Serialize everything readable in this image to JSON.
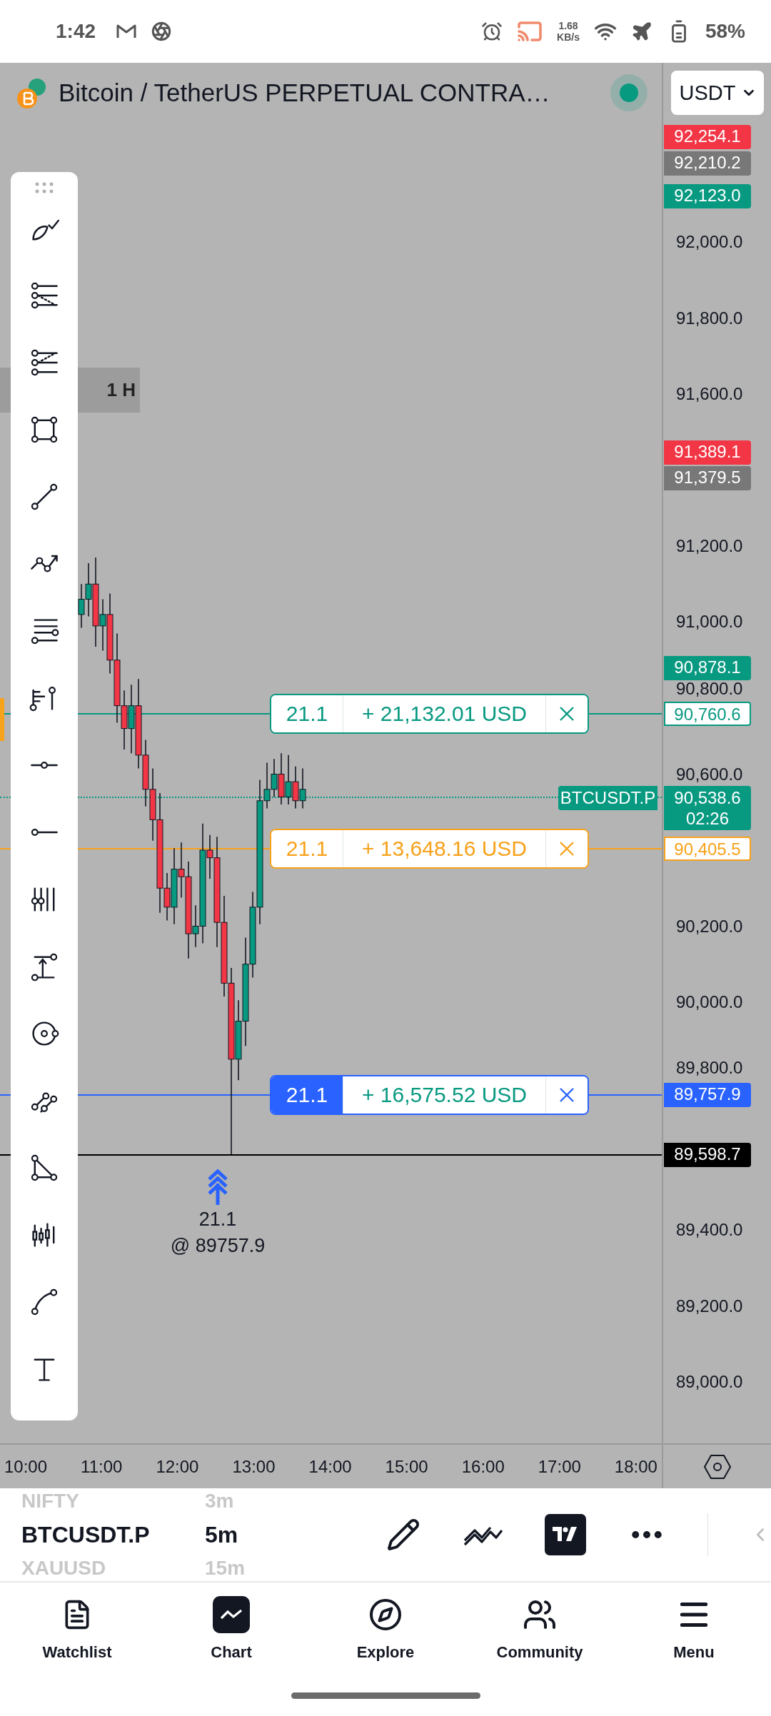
{
  "status_bar": {
    "time": "1:42",
    "net_speed": "1.68",
    "net_unit": "KB/s",
    "battery": "58%"
  },
  "header": {
    "title": "Bitcoin / TetherUS PERPETUAL CONTRA…",
    "live": true,
    "currency": "USDT"
  },
  "interval_label": "1 H",
  "price_axis": [
    {
      "label": "92,254.1",
      "kind": "tag",
      "color": "#f23645"
    },
    {
      "label": "92,210.2",
      "kind": "tag",
      "color": "#787878"
    },
    {
      "label": "92,123.0",
      "kind": "tag",
      "color": "#089981"
    },
    {
      "label": "92,000.0",
      "kind": "tick"
    },
    {
      "label": "91,800.0",
      "kind": "tick"
    },
    {
      "label": "91,600.0",
      "kind": "tick"
    },
    {
      "label": "91,389.1",
      "kind": "tag",
      "color": "#f23645"
    },
    {
      "label": "91,379.5",
      "kind": "tag",
      "color": "#787878"
    },
    {
      "label": "91,200.0",
      "kind": "tick"
    },
    {
      "label": "91,000.0",
      "kind": "tick"
    },
    {
      "label": "90,878.1",
      "kind": "tag",
      "color": "#089981"
    },
    {
      "label": "90,800.0",
      "kind": "tick"
    },
    {
      "label": "90,760.6",
      "kind": "outline",
      "color": "#089981"
    },
    {
      "label": "90,600.0",
      "kind": "tick"
    },
    {
      "label": "90,405.5",
      "kind": "outline",
      "color": "#f7a21b"
    },
    {
      "label": "90,200.0",
      "kind": "tick"
    },
    {
      "label": "90,000.0",
      "kind": "tick"
    },
    {
      "label": "89,800.0",
      "kind": "tick"
    },
    {
      "label": "89,757.9",
      "kind": "tag",
      "color": "#2962ff"
    },
    {
      "label": "89,598.7",
      "kind": "crosshair",
      "color": "#000000"
    },
    {
      "label": "89,400.0",
      "kind": "tick"
    },
    {
      "label": "89,200.0",
      "kind": "tick"
    },
    {
      "label": "89,000.0",
      "kind": "tick"
    }
  ],
  "positions": [
    {
      "qty": "21.1",
      "pnl": "+ 21,132.01 USD",
      "color": "#089981",
      "selected": false
    },
    {
      "qty": "21.1",
      "pnl": "+ 13,648.16 USD",
      "color": "#f7a21b",
      "selected": false
    },
    {
      "qty": "21.1",
      "pnl": "+ 16,575.52 USD",
      "color": "#2962ff",
      "selected": true
    }
  ],
  "symbol_tag": {
    "name": "BTCUSDT.P",
    "price": "90,538.6",
    "countdown": "02:26"
  },
  "execution": {
    "qty": "21.1",
    "price": "@ 89757.9"
  },
  "time_axis": [
    "10:00",
    "11:00",
    "12:00",
    "13:00",
    "14:00",
    "15:00",
    "16:00",
    "17:00",
    "18:00"
  ],
  "symbol_picker": [
    {
      "symbol": "NIFTY",
      "interval": "3m",
      "selected": false
    },
    {
      "symbol": "BTCUSDT.P",
      "interval": "5m",
      "selected": true
    },
    {
      "symbol": "XAUUSD",
      "interval": "15m",
      "selected": false
    }
  ],
  "nav": [
    {
      "label": "Watchlist",
      "selected": false
    },
    {
      "label": "Chart",
      "selected": true
    },
    {
      "label": "Explore",
      "selected": false
    },
    {
      "label": "Community",
      "selected": false
    },
    {
      "label": "Menu",
      "selected": false
    }
  ]
}
